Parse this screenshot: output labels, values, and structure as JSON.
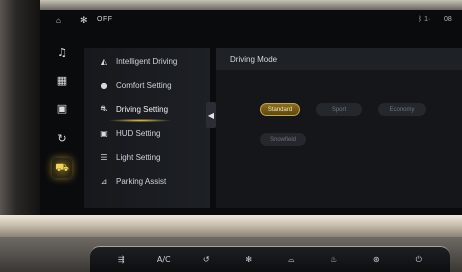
{
  "status_bar": {
    "fan_state": "OFF",
    "icons": [
      "home-icon",
      "fan-icon",
      "bluetooth-icon"
    ],
    "right_a": "ᛒ 1·",
    "right_b": "08"
  },
  "rail": {
    "icons": [
      "music-icon",
      "navigation-icon",
      "media-icon",
      "vehicle-control-icon",
      "car-icon"
    ],
    "active_index": 4
  },
  "menu": {
    "items": [
      {
        "label": "Intelligent Driving",
        "icon": "steering-assist-icon"
      },
      {
        "label": "Comfort Setting",
        "icon": "comfort-icon"
      },
      {
        "label": "Driving Setting",
        "icon": "driving-icon"
      },
      {
        "label": "HUD Setting",
        "icon": "hud-icon"
      },
      {
        "label": "Light Setting",
        "icon": "light-icon"
      },
      {
        "label": "Parking Assist",
        "icon": "parking-icon"
      }
    ],
    "selected": "Driving Setting"
  },
  "panel": {
    "title": "Driving Mode",
    "modes": [
      "Standard",
      "Sport",
      "Economy",
      "Snowfield"
    ],
    "selected_mode": "Standard"
  },
  "hardware_buttons": [
    "rear-defrost-icon",
    "A/C",
    "recirculation-icon",
    "fan-speed-icon",
    "front-defrost-icon",
    "seat-heat-icon",
    "steering-heat-icon",
    "power-icon"
  ],
  "colors": {
    "accent": "#e8c04a",
    "screen_bg": "#0a0b0d",
    "menu_bg": "#1b1e23"
  }
}
